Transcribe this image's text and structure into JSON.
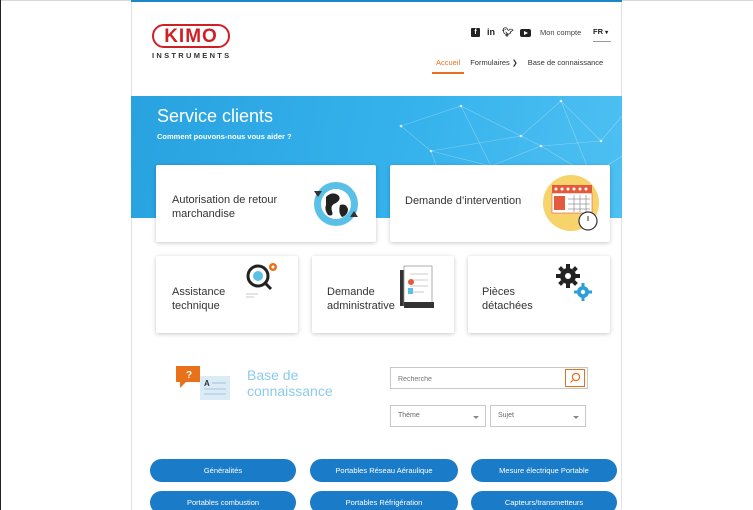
{
  "header": {
    "logo_text": "KIMO",
    "logo_sub": "INSTRUMENTS",
    "social": [
      "facebook-icon",
      "linkedin-icon",
      "twitter-icon",
      "youtube-icon"
    ],
    "account_label": "Mon compte",
    "lang_label": "FR",
    "nav": [
      {
        "label": "Accueil",
        "active": true
      },
      {
        "label": "Formulaires",
        "active": false
      },
      {
        "label": "Base de connaissance",
        "active": false
      }
    ]
  },
  "hero": {
    "title": "Service clients",
    "subtitle": "Comment pouvons-nous vous aider ?"
  },
  "cards": {
    "retour": "Autorisation de retour marchandise",
    "intervention": "Demande d’intervention",
    "assistance": "Assistance technique",
    "administrative": "Demande administrative",
    "pieces": "Pièces détachées"
  },
  "kb": {
    "title": "Base de connaissance",
    "search_placeholder": "Recherche",
    "theme_label": "Thème",
    "sujet_label": "Sujet"
  },
  "categories": [
    "Généralités",
    "Portables Réseau Aéraulique",
    "Mesure électrique Portable",
    "Portables combustion",
    "Portables Réfrigération",
    "Capteurs/transmetteurs"
  ],
  "colors": {
    "brand_red": "#d11f26",
    "accent_orange": "#e8711a",
    "hero_blue": "#29a2e0",
    "pill_blue": "#1a7cc8"
  }
}
